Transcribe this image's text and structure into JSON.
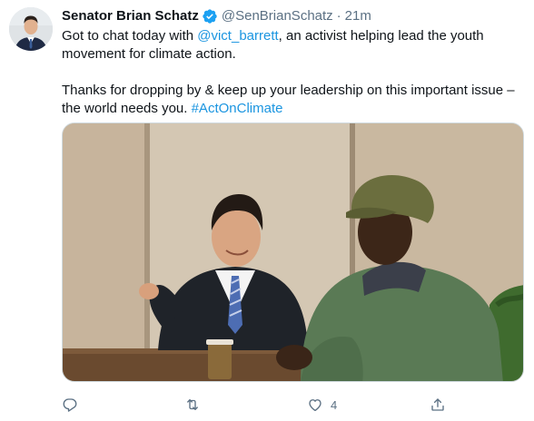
{
  "author": {
    "display_name": "Senator Brian Schatz",
    "handle": "@SenBrianSchatz",
    "separator": "·",
    "time": "21m",
    "verified": true
  },
  "tweet": {
    "line1_prefix": "Got to chat today with ",
    "mention": "@vict_barrett",
    "line1_suffix": ", an activist helping lead the youth movement for climate action.",
    "line2": "Thanks for dropping by & keep up your leadership on this important issue – the world needs you. ",
    "hashtag": "#ActOnClimate"
  },
  "actions": {
    "reply_icon": "reply-icon",
    "retweet_icon": "retweet-icon",
    "like_icon": "heart-icon",
    "like_count": "4",
    "share_icon": "share-icon"
  },
  "colors": {
    "link": "#1b95e0",
    "verified_badge": "#1da1f2",
    "meta_text": "#5b7083"
  }
}
